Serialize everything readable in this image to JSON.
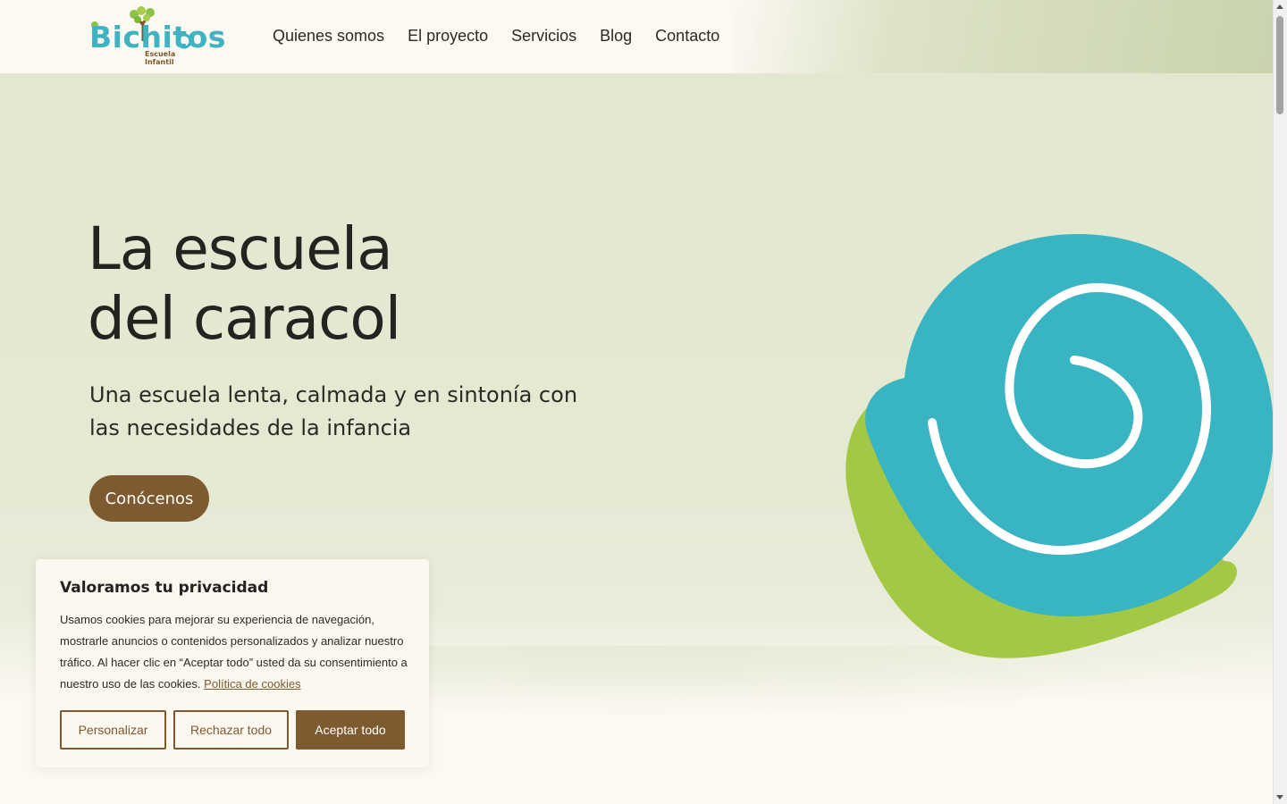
{
  "header": {
    "logo": {
      "word": "Bichitos",
      "tagline": "Escuela Infantil"
    },
    "nav": [
      "Quienes somos",
      "El proyecto",
      "Servicios",
      "Blog",
      "Contacto"
    ]
  },
  "hero": {
    "title_line1": "La escuela",
    "title_line2": "del caracol",
    "subtitle": "Una escuela lenta, calmada y en sintonía con las necesidades de la infancia",
    "cta": "Conócenos"
  },
  "cookie_banner": {
    "title": "Valoramos tu privacidad",
    "text": "Usamos cookies para mejorar su experiencia de navegación, mostrarle anuncios o contenidos personalizados y analizar nuestro tráfico. Al hacer clic en “Aceptar todo” usted da su consentimiento a nuestro uso de las cookies.",
    "policy_link": "Política de cookies",
    "buttons": {
      "customize": "Personalizar",
      "reject": "Rechazar todo",
      "accept": "Aceptar todo"
    }
  },
  "colors": {
    "brand_brown": "#7d5a2f",
    "snail_blue": "#38b4c2",
    "snail_green": "#a3c843",
    "hero_bg": "#e3e8d1"
  }
}
